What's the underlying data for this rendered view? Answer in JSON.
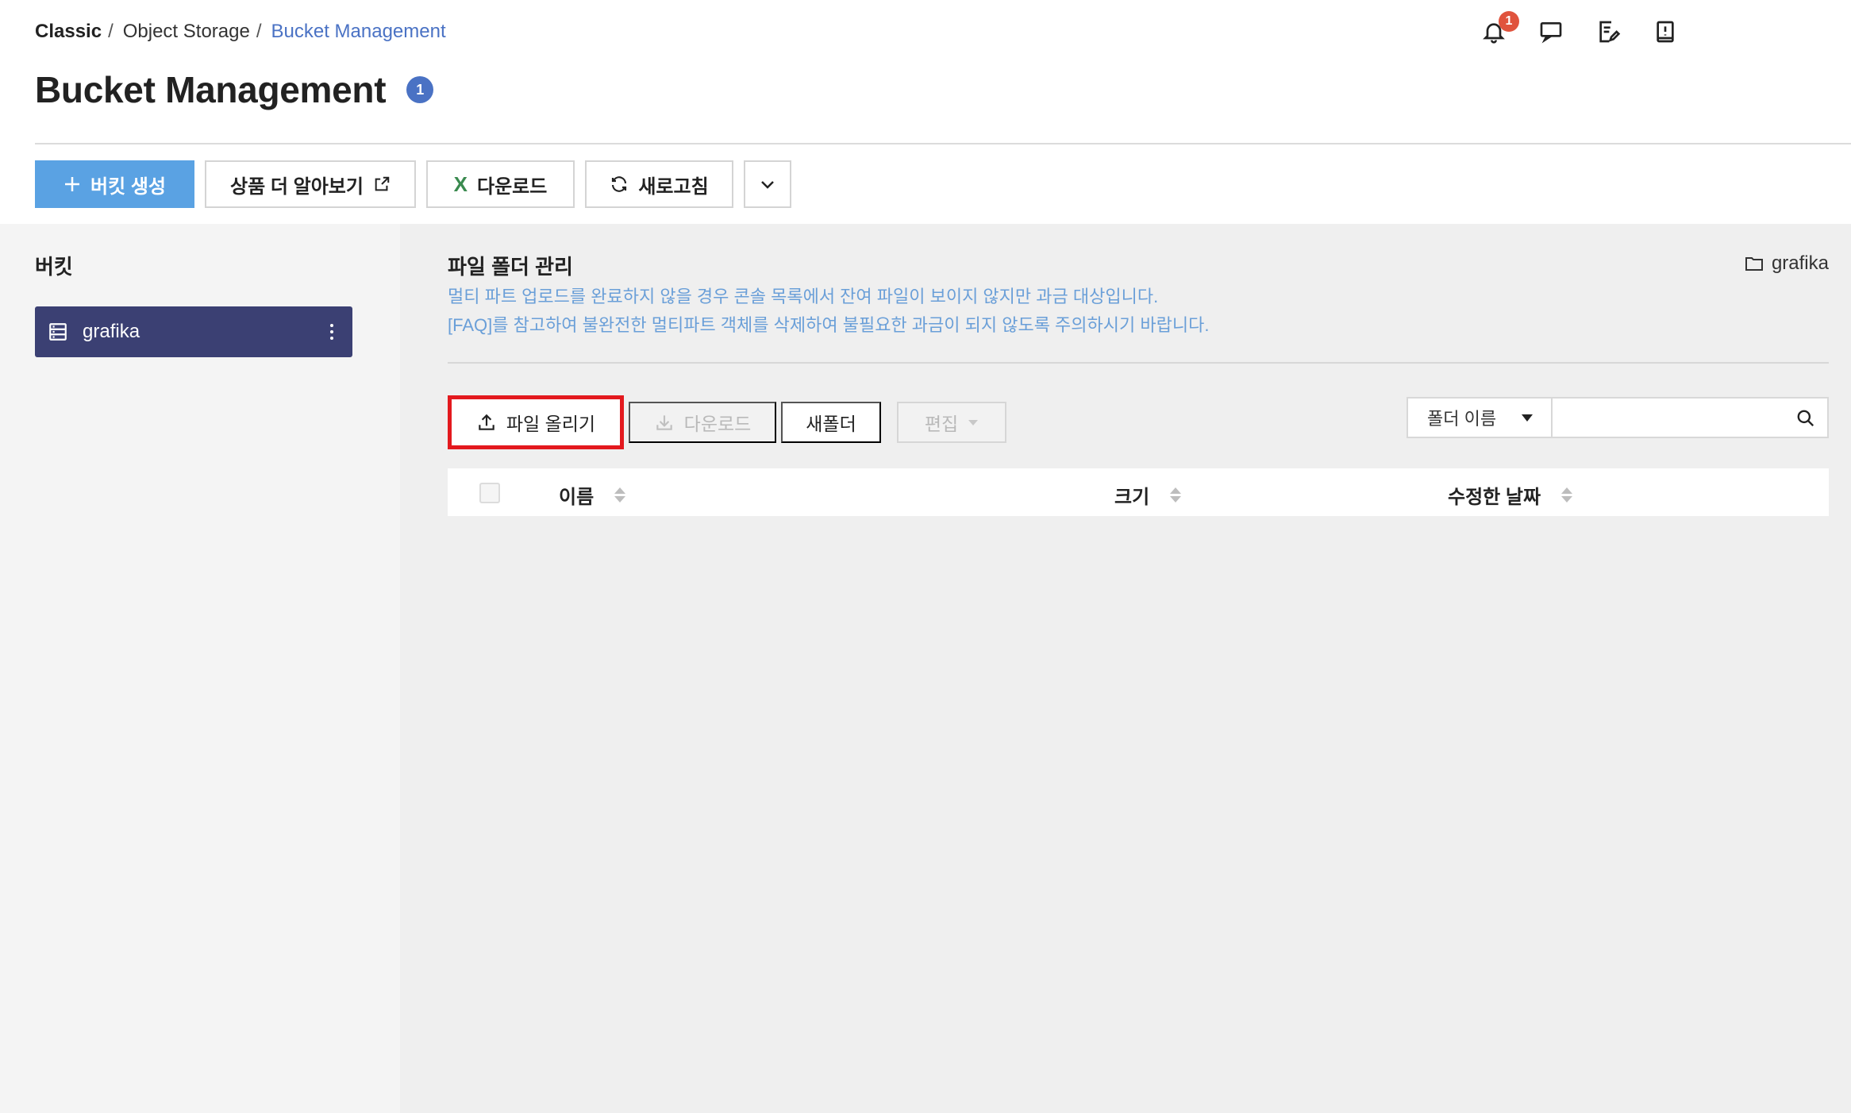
{
  "breadcrumb": {
    "root": "Classic",
    "middle": "Object Storage",
    "current": "Bucket Management",
    "separator": "/"
  },
  "page": {
    "title": "Bucket Management",
    "badge_count": "1"
  },
  "header_icons": {
    "notification_count": "1",
    "icons": [
      "bell-icon",
      "chat-icon",
      "memo-icon",
      "guide-book-icon"
    ]
  },
  "toolbar": {
    "create_bucket": "버킷 생성",
    "learn_more": "상품 더 알아보기",
    "download": "다운로드",
    "refresh": "새로고침"
  },
  "sidebar": {
    "title": "버킷",
    "buckets": [
      {
        "label": "grafika",
        "selected": true
      }
    ]
  },
  "main": {
    "title": "파일 폴더 관리",
    "info_line_1": "멀티 파트 업로드를 완료하지 않을 경우 콘솔 목록에서 잔여 파일이 보이지 않지만 과금 대상입니다.",
    "info_line_2": "[FAQ]를 참고하여 불완전한 멀티파트 객체를 삭제하여 불필요한 과금이 되지 않도록 주의하시기 바랍니다.",
    "folder_path": "grafika",
    "actions": {
      "upload": "파일 올리기",
      "download": "다운로드",
      "new_folder": "새폴더",
      "edit": "편집"
    },
    "search": {
      "select_value": "폴더 이름",
      "placeholder": ""
    },
    "table": {
      "columns": [
        "이름",
        "크기",
        "수정한 날짜"
      ]
    }
  },
  "colors": {
    "primary_button": "#5aa2e3",
    "bucket_selected": "#3b4073",
    "link_blue": "#4a72c4",
    "info_text": "#6a9fd8",
    "highlight_box": "#e3191e",
    "notification_badge": "#e0533d"
  }
}
